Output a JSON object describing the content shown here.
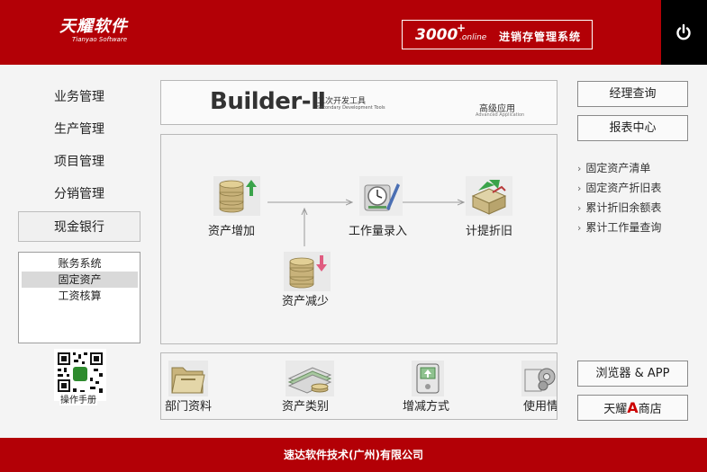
{
  "header": {
    "logo_cn": "天耀软件",
    "logo_en": "Tianyao Software",
    "product_number": "3000",
    "product_plus": "+",
    "product_online": ".online",
    "product_name": "进销存管理系统",
    "icons": [
      "power-icon"
    ]
  },
  "sidebar": {
    "items": [
      {
        "label": "业务管理"
      },
      {
        "label": "生产管理"
      },
      {
        "label": "项目管理"
      },
      {
        "label": "分销管理"
      },
      {
        "label": "现金银行"
      }
    ],
    "active_item": "现金银行",
    "sub_items": [
      {
        "label": "账务系统"
      },
      {
        "label": "固定资产"
      },
      {
        "label": "工资核算"
      }
    ],
    "active_sub_item": "固定资产",
    "qr_label": "操作手册"
  },
  "banner": {
    "title": "Builder-Ⅱ",
    "subtitle_cn": "二次开发工具",
    "subtitle_en": "Secondary Development Tools",
    "advanced_cn": "高级应用",
    "advanced_en": "Advanced Application"
  },
  "flow": {
    "nodes": [
      {
        "label": "资产增加",
        "icon": "coins-up-icon"
      },
      {
        "label": "工作量录入",
        "icon": "clock-pen-icon"
      },
      {
        "label": "计提折旧",
        "icon": "box-arrow-icon"
      },
      {
        "label": "资产减少",
        "icon": "coins-down-icon"
      }
    ]
  },
  "modules": [
    {
      "label": "部门资料",
      "icon": "folder-icon"
    },
    {
      "label": "资产类别",
      "icon": "money-stack-icon"
    },
    {
      "label": "增减方式",
      "icon": "phone-icon"
    },
    {
      "label": "使用情况",
      "icon": "gear-icon"
    }
  ],
  "right": {
    "buttons": [
      {
        "label": "经理查询"
      },
      {
        "label": "报表中心"
      }
    ],
    "links": [
      {
        "label": "固定资产清单"
      },
      {
        "label": "固定资产折旧表"
      },
      {
        "label": "累计折旧余额表"
      },
      {
        "label": "累计工作量查询"
      }
    ],
    "browser_label": "浏览器 & APP",
    "shop_pre": "天耀",
    "shop_letter": "A",
    "shop_post": "商店"
  },
  "footer": {
    "text": "速达软件技术(广州)有限公司"
  },
  "colors": {
    "brand_red": "#b30006",
    "power_bg": "#000000",
    "active_sub_bg": "#d9d9d9"
  }
}
